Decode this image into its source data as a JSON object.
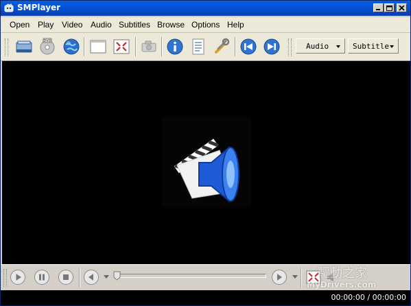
{
  "window": {
    "title": "SMPlayer"
  },
  "menu": [
    "Open",
    "Play",
    "Video",
    "Audio",
    "Subtitles",
    "Browse",
    "Options",
    "Help"
  ],
  "toolbar": {
    "icons": [
      "open-file-icon",
      "open-dvd-icon",
      "open-url-icon",
      "fullscreen-window-icon",
      "compact-mode-icon",
      "screenshot-icon",
      "info-icon",
      "playlist-icon",
      "preferences-icon",
      "previous-icon",
      "next-icon"
    ],
    "audio_combo": "Audio",
    "subtitle_combo": "Subtitle"
  },
  "controls": {
    "icons": [
      "play-icon",
      "pause-icon",
      "stop-icon",
      "rewind-icon",
      "forward-icon",
      "fullscreen-icon",
      "mute-icon"
    ],
    "progress": 0
  },
  "watermark": {
    "line1": "驅動之家",
    "line2": "MyDrivers.com"
  },
  "status": {
    "time": "00:00:00 / 00:00:00"
  }
}
